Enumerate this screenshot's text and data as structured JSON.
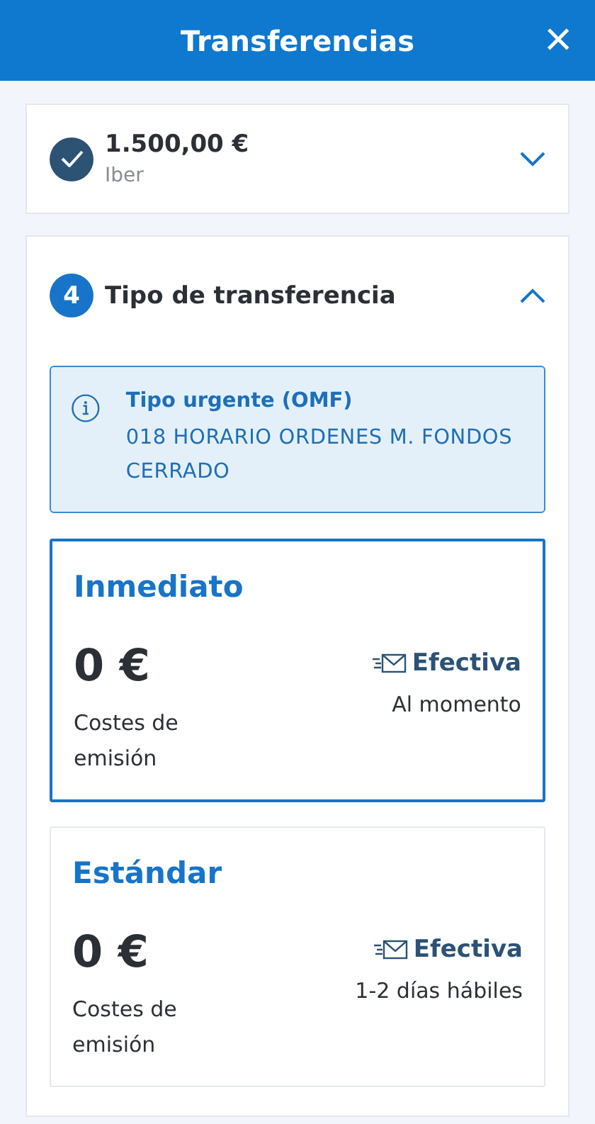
{
  "header": {
    "title": "Transferencias",
    "close": "×"
  },
  "steps": [
    {
      "kind": "done",
      "title": "1.500,00 €",
      "subtitle": "Iber",
      "expanded": false
    },
    {
      "kind": "active",
      "number": "4",
      "title": "Tipo de transferencia",
      "expanded": true,
      "notice": {
        "title": "Tipo urgente (OMF)",
        "text": "018 HORARIO ORDENES M. FONDOS CERRADO"
      },
      "options": [
        {
          "name": "Inmediato",
          "selected": true,
          "cost": "0 €",
          "cost_label": "Costes de emisión",
          "status": "Efectiva",
          "timing": "Al momento"
        },
        {
          "name": "Estándar",
          "selected": false,
          "cost": "0 €",
          "cost_label": "Costes de emisión",
          "status": "Efectiva",
          "timing": "1-2 días hábiles"
        }
      ]
    }
  ]
}
